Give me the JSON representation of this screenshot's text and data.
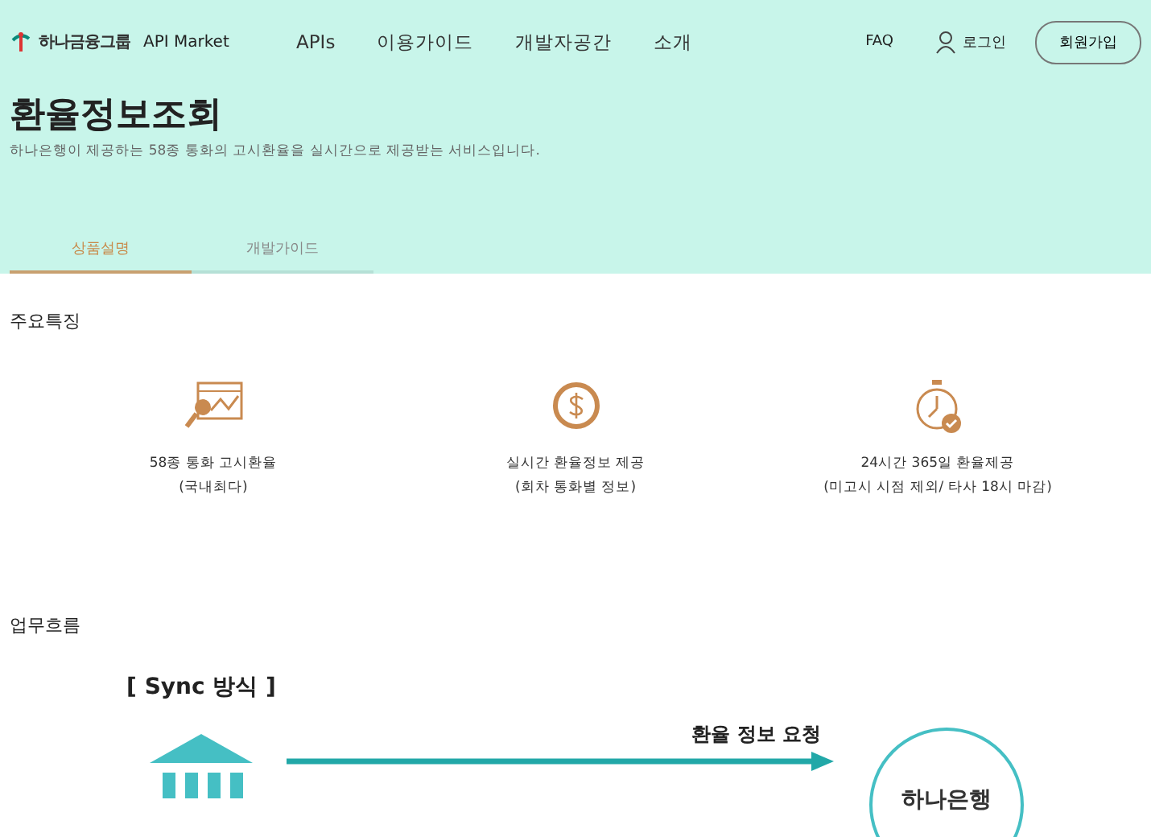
{
  "header": {
    "logo": {
      "brand": "하나금융그룹",
      "product": "API Market"
    },
    "nav": [
      {
        "label": "APIs"
      },
      {
        "label": "이용가이드"
      },
      {
        "label": "개발자공간"
      },
      {
        "label": "소개"
      }
    ],
    "faq": "FAQ",
    "login": "로그인",
    "signup": "회원가입"
  },
  "hero": {
    "title": "환율정보조회",
    "description": "하나은행이 제공하는 58종 통화의 고시환율을 실시간으로 제공받는 서비스입니다.",
    "tabs": [
      {
        "label": "상품설명",
        "selected": true
      },
      {
        "label": "개발가이드",
        "selected": false
      }
    ]
  },
  "features": {
    "heading": "주요특징",
    "items": [
      {
        "kind": "chart",
        "line1": "58종 통화 고시환율",
        "line2": "(국내최다)"
      },
      {
        "kind": "dollar",
        "line1": "실시간 환율정보 제공",
        "line2": "(회차 통화별 정보)"
      },
      {
        "kind": "stopwatch",
        "line1": "24시간 365일 환율제공",
        "line2": "(미고시 시점 제외/ 타사 18시 마감)"
      }
    ]
  },
  "workflow": {
    "heading": "업무흐름",
    "mode": "[ Sync 방식 ]",
    "arrow_label": "환율 정보 요청",
    "bank_label": "하나은행"
  }
}
